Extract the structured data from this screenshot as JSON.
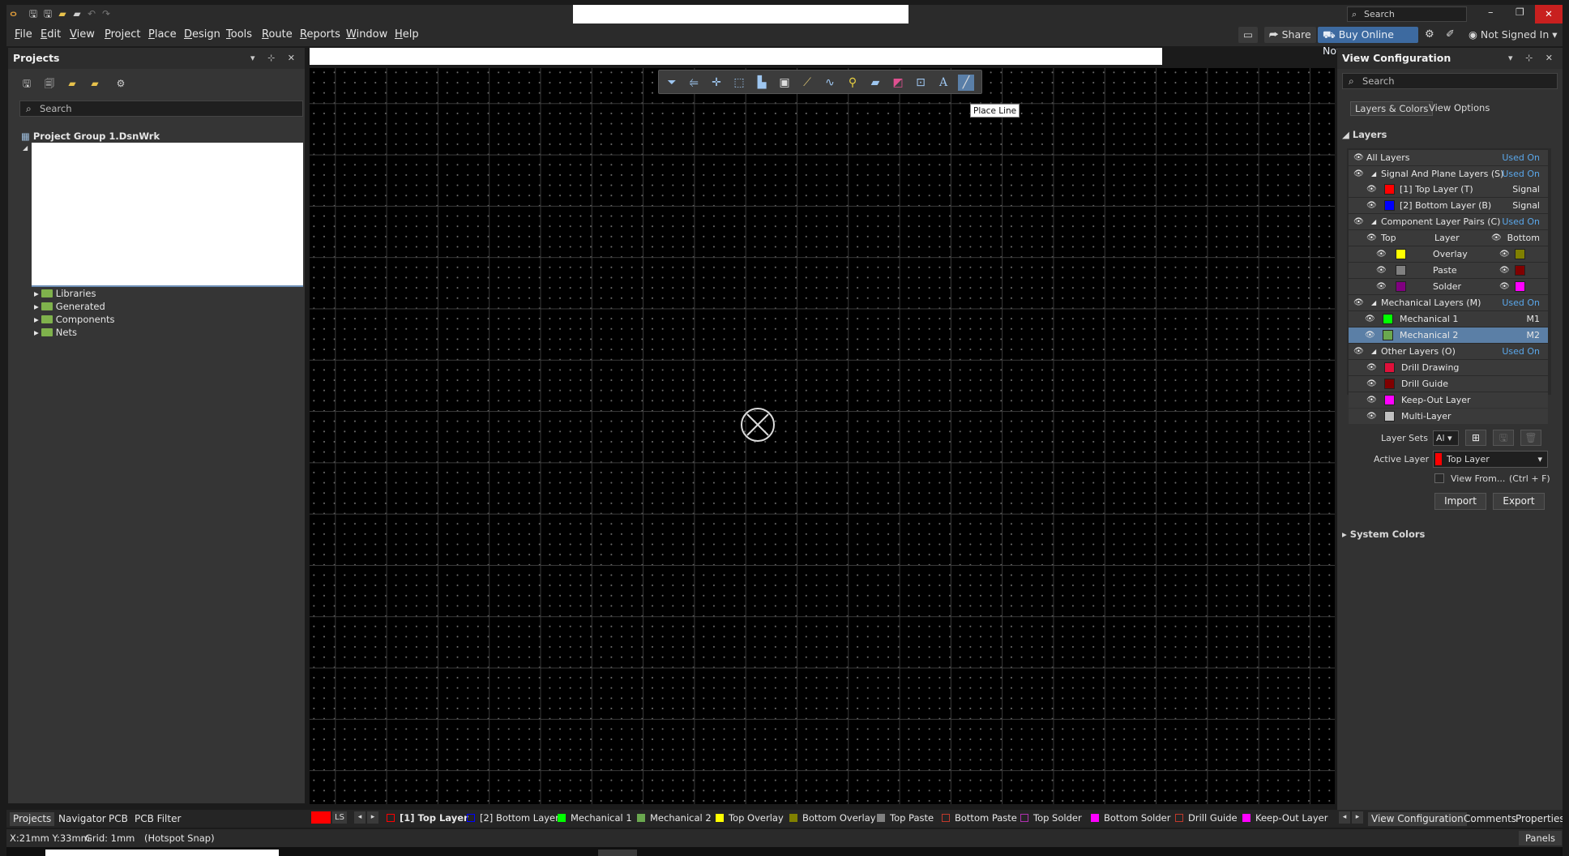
{
  "titlebar": {
    "search_placeholder": "Search",
    "min": "–",
    "restore": "❐",
    "close": "✕"
  },
  "menu": [
    "File",
    "Edit",
    "View",
    "Project",
    "Place",
    "Design",
    "Tools",
    "Route",
    "Reports",
    "Window",
    "Help"
  ],
  "menubar_right": {
    "share": "Share",
    "buy": "Buy Online Now",
    "user": "Not Signed In"
  },
  "left_panel": {
    "title": "Projects",
    "search_placeholder": "Search",
    "project_group": "Project Group 1.DsnWrk",
    "folders": [
      "Libraries",
      "Generated",
      "Components",
      "Nets"
    ]
  },
  "canvas": {
    "tooltip": "Place Line"
  },
  "right_panel": {
    "title": "View Configuration",
    "search_placeholder": "Search",
    "tabs": [
      "Layers & Colors",
      "View Options"
    ],
    "layers_header": "Layers",
    "all_layers": "All Layers",
    "used_on": "Used On",
    "signal_group": "Signal And Plane Layers (S)",
    "signal_layers": [
      {
        "name": "[1] Top Layer (T)",
        "type": "Signal",
        "color": "#ff0000"
      },
      {
        "name": "[2] Bottom Layer (B)",
        "type": "Signal",
        "color": "#0000ff"
      }
    ],
    "component_group": "Component Layer Pairs (C)",
    "pair_header": {
      "top": "Top",
      "layer": "Layer",
      "bottom": "Bottom"
    },
    "pairs": [
      {
        "name": "Overlay",
        "top_color": "#ffff00",
        "bottom_color": "#808000"
      },
      {
        "name": "Paste",
        "top_color": "#808080",
        "bottom_color": "#800000"
      },
      {
        "name": "Solder",
        "top_color": "#800080",
        "bottom_color": "#ff00ff"
      }
    ],
    "mech_group": "Mechanical Layers (M)",
    "mech_layers": [
      {
        "name": "Mechanical 1",
        "code": "M1",
        "color": "#00ff00"
      },
      {
        "name": "Mechanical 2",
        "code": "M2",
        "color": "#6aa84f"
      }
    ],
    "other_group": "Other Layers (O)",
    "other_layers": [
      {
        "name": "Drill Drawing",
        "color": "#e0103a"
      },
      {
        "name": "Drill Guide",
        "color": "#800000"
      },
      {
        "name": "Keep-Out Layer",
        "color": "#ff00ff"
      },
      {
        "name": "Multi-Layer",
        "color": "#c0c0c0"
      }
    ],
    "layer_sets_label": "Layer Sets",
    "layer_sets_value": "Al",
    "active_layer_label": "Active Layer",
    "active_layer_value": "Top Layer",
    "view_from": "View From...",
    "view_from_shortcut": "(Ctrl + F)",
    "import": "Import",
    "export": "Export",
    "system_colors": "System Colors"
  },
  "bottom_left_tabs": [
    "Projects",
    "Navigator",
    "PCB",
    "PCB Filter"
  ],
  "layer_tabs": {
    "ls": "LS",
    "items": [
      {
        "name": "[1] Top Layer",
        "color": "#ff0000"
      },
      {
        "name": "[2] Bottom Layer",
        "color": "#0000ff"
      },
      {
        "name": "Mechanical 1",
        "color": "#00ff00"
      },
      {
        "name": "Mechanical 2",
        "color": "#6aa84f"
      },
      {
        "name": "Top Overlay",
        "color": "#ffff00"
      },
      {
        "name": "Bottom Overlay",
        "color": "#808000"
      },
      {
        "name": "Top Paste",
        "color": "#808080"
      },
      {
        "name": "Bottom Paste",
        "color": "#800000"
      },
      {
        "name": "Top Solder",
        "color": "#800080"
      },
      {
        "name": "Bottom Solder",
        "color": "#ff00ff"
      },
      {
        "name": "Drill Guide",
        "color": "#800000"
      },
      {
        "name": "Keep-Out Layer",
        "color": "#ff00ff"
      }
    ]
  },
  "bottom_right_tabs": [
    "View Configuration",
    "Comments",
    "Properties"
  ],
  "status": {
    "coords": "X:21mm Y:33mm",
    "grid": "Grid: 1mm",
    "snap": "(Hotspot Snap)",
    "panels": "Panels"
  }
}
